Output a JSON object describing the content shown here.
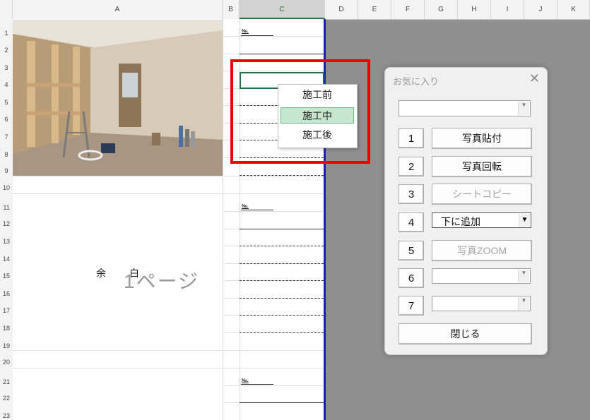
{
  "columns": [
    "A",
    "B",
    "C",
    "D",
    "E",
    "F",
    "G",
    "H",
    "I",
    "J",
    "K"
  ],
  "rows": [
    "1",
    "2",
    "3",
    "4",
    "5",
    "6",
    "7",
    "8",
    "9",
    "10",
    "11",
    "12",
    "13",
    "14",
    "15",
    "16",
    "17",
    "18",
    "19",
    "20",
    "21",
    "22",
    "23"
  ],
  "sheet": {
    "no_label": "№.",
    "yohaku_1": "余",
    "yohaku_2": "白",
    "page_label": "1ページ"
  },
  "context_menu": {
    "items": [
      "施工前",
      "施工中",
      "施工後"
    ],
    "selected": "施工中"
  },
  "dialog": {
    "title": "お気に入り",
    "close": "✕",
    "numbers": [
      "1",
      "2",
      "3",
      "4",
      "5",
      "6",
      "7"
    ],
    "actions": {
      "paste_photo": "写真貼付",
      "rotate_photo": "写真回転",
      "sheet_copy": "シートコピー",
      "add_below": "下に追加",
      "photo_zoom": "写真ZOOM",
      "close": "閉じる"
    }
  },
  "colors": {
    "accent": "#217346",
    "highlight": "#ee0000",
    "border_blue": "#1d1db0"
  }
}
